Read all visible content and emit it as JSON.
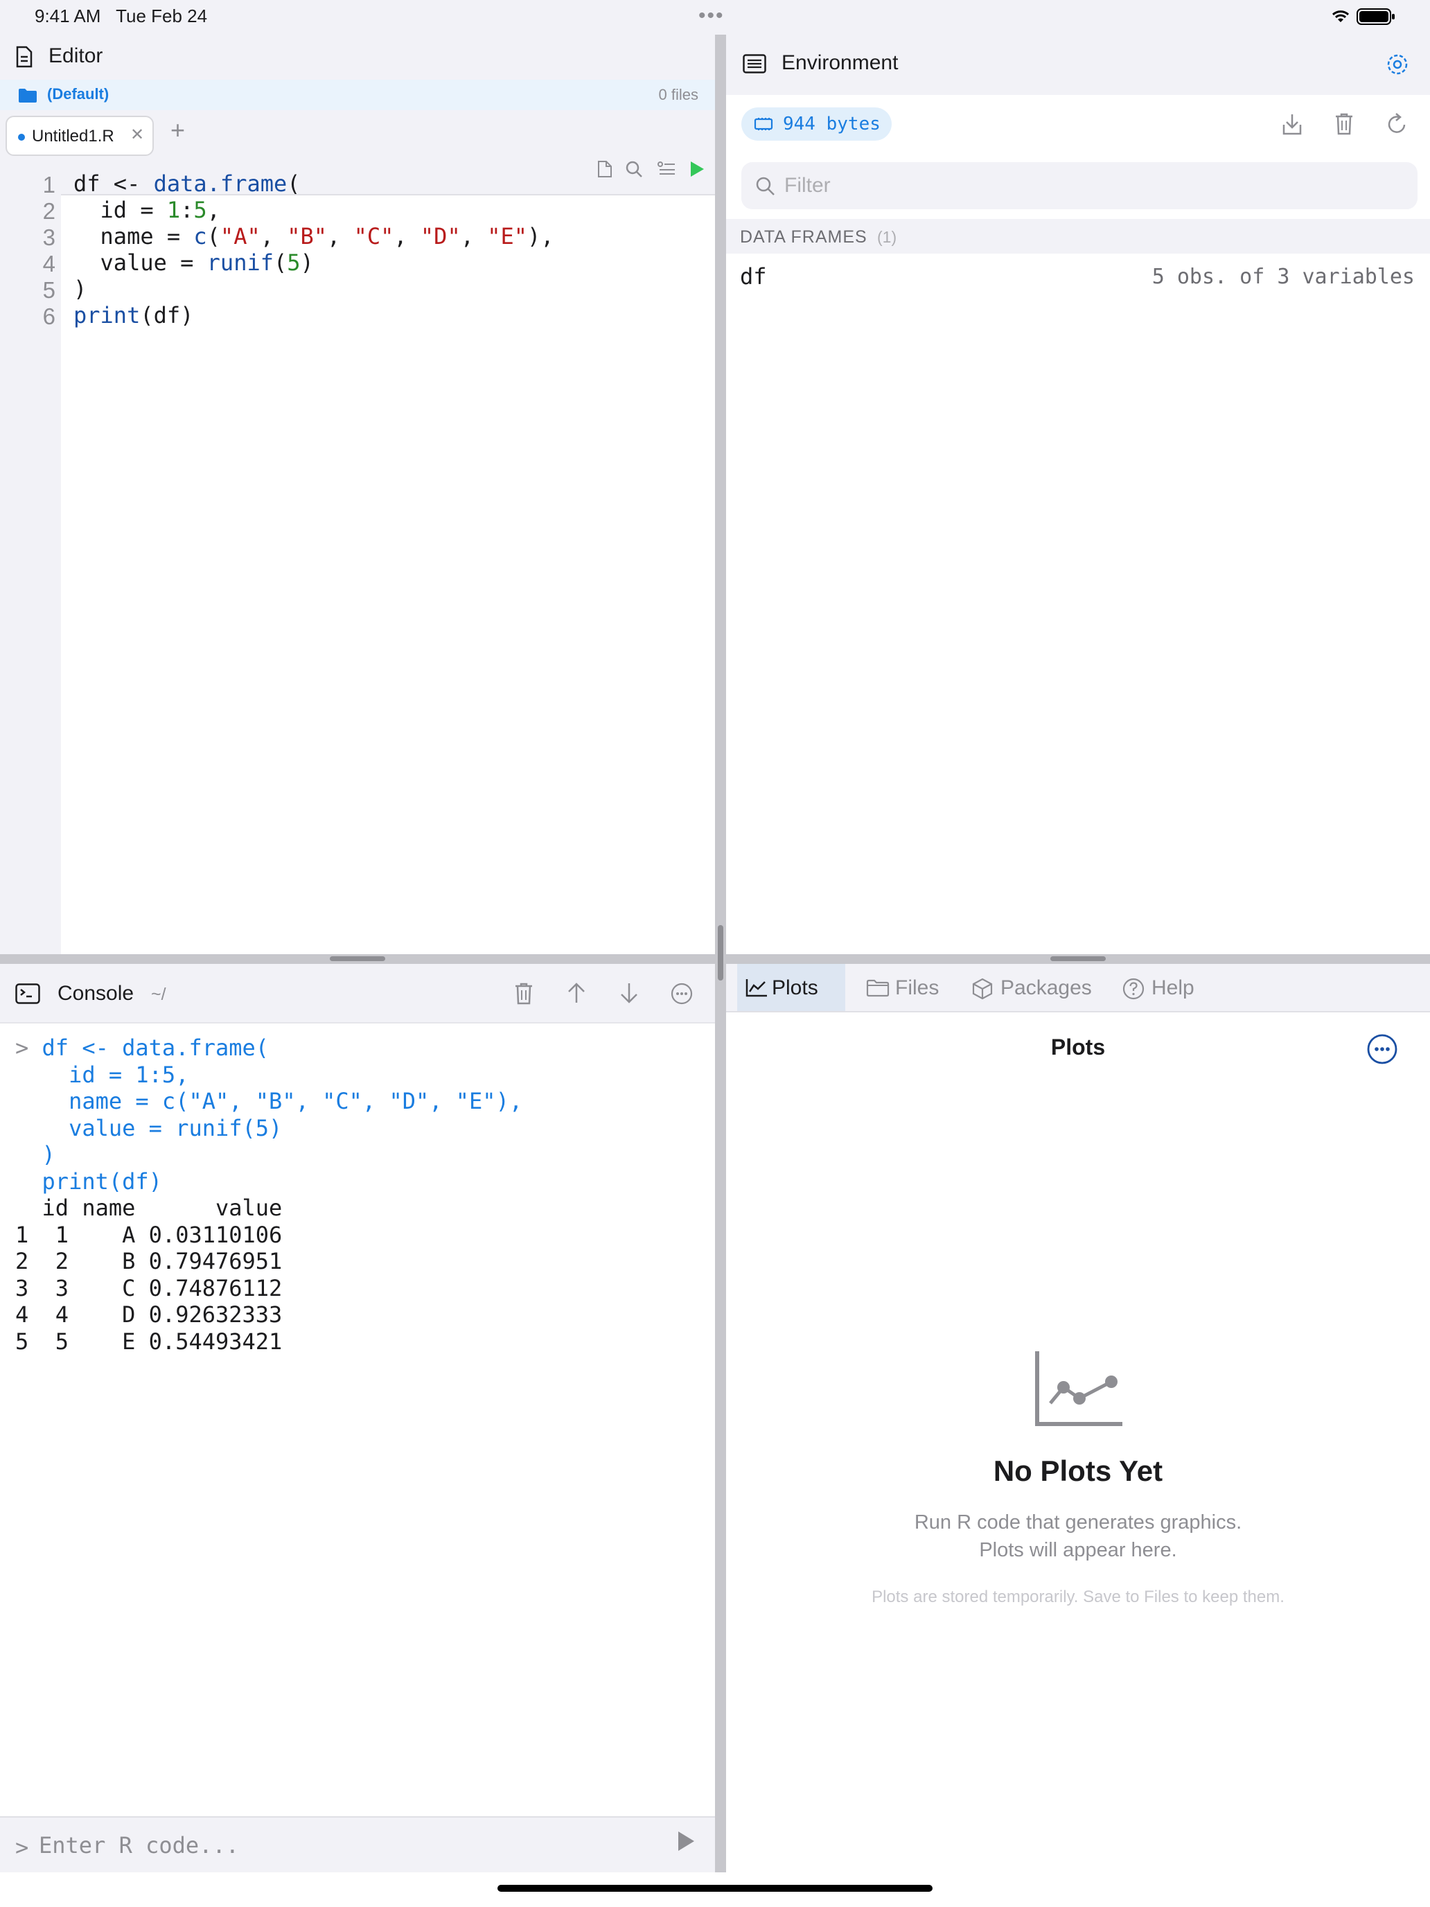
{
  "status_bar": {
    "time": "9:41 AM",
    "date": "Tue Feb 24"
  },
  "editor": {
    "title": "Editor",
    "folder": {
      "name": "(Default)",
      "count": "0 files"
    },
    "tabs": [
      {
        "label": "Untitled1.R",
        "modified": true
      }
    ],
    "line_numbers": [
      "1",
      "2",
      "3",
      "4",
      "5",
      "6"
    ],
    "code_lines": [
      "df <- data.frame(",
      "  id = 1:5,",
      "  name = c(\"A\", \"B\", \"C\", \"D\", \"E\"),",
      "  value = runif(5)",
      ")",
      "print(df)"
    ]
  },
  "console": {
    "title": "Console",
    "path": "~/",
    "input_lines": [
      "> df <- data.frame(",
      "    id = 1:5,",
      "    name = c(\"A\", \"B\", \"C\", \"D\", \"E\"),",
      "    value = runif(5)",
      "  )",
      "  print(df)"
    ],
    "output_lines": [
      "  id name      value",
      "1  1    A 0.03110106",
      "2  2    B 0.79476951",
      "3  3    C 0.74876112",
      "4  4    D 0.92632333",
      "5  5    E 0.54493421"
    ],
    "prompt": ">",
    "input_placeholder": "Enter R code..."
  },
  "environment": {
    "title": "Environment",
    "memory": "944 bytes",
    "filter_placeholder": "Filter",
    "section": {
      "title": "DATA FRAMES",
      "count": "(1)"
    },
    "items": [
      {
        "name": "df",
        "description": "5 obs. of 3 variables"
      }
    ]
  },
  "plots_panel": {
    "tabs": [
      "Plots",
      "Files",
      "Packages",
      "Help"
    ],
    "active_tab": "Plots",
    "title": "Plots",
    "empty_title": "No Plots Yet",
    "empty_line1": "Run R code that generates graphics.",
    "empty_line2": "Plots will appear here.",
    "empty_note": "Plots are stored temporarily. Save to Files to keep them."
  },
  "colors": {
    "accent": "#1a7de0",
    "run_green": "#34c759",
    "keyword": "#1a4fa3",
    "string": "#b81b1b",
    "number": "#2a8a2a"
  },
  "icons": [
    "document-icon",
    "folder-icon",
    "search-icon",
    "run-icon",
    "terminal-icon",
    "trash-icon",
    "arrow-up-icon",
    "arrow-down-icon",
    "more-icon",
    "list-icon",
    "gear-icon",
    "memory-chip-icon",
    "import-icon",
    "refresh-icon",
    "chart-line-icon",
    "files-icon",
    "package-icon",
    "help-icon",
    "wifi-icon",
    "battery-icon"
  ]
}
